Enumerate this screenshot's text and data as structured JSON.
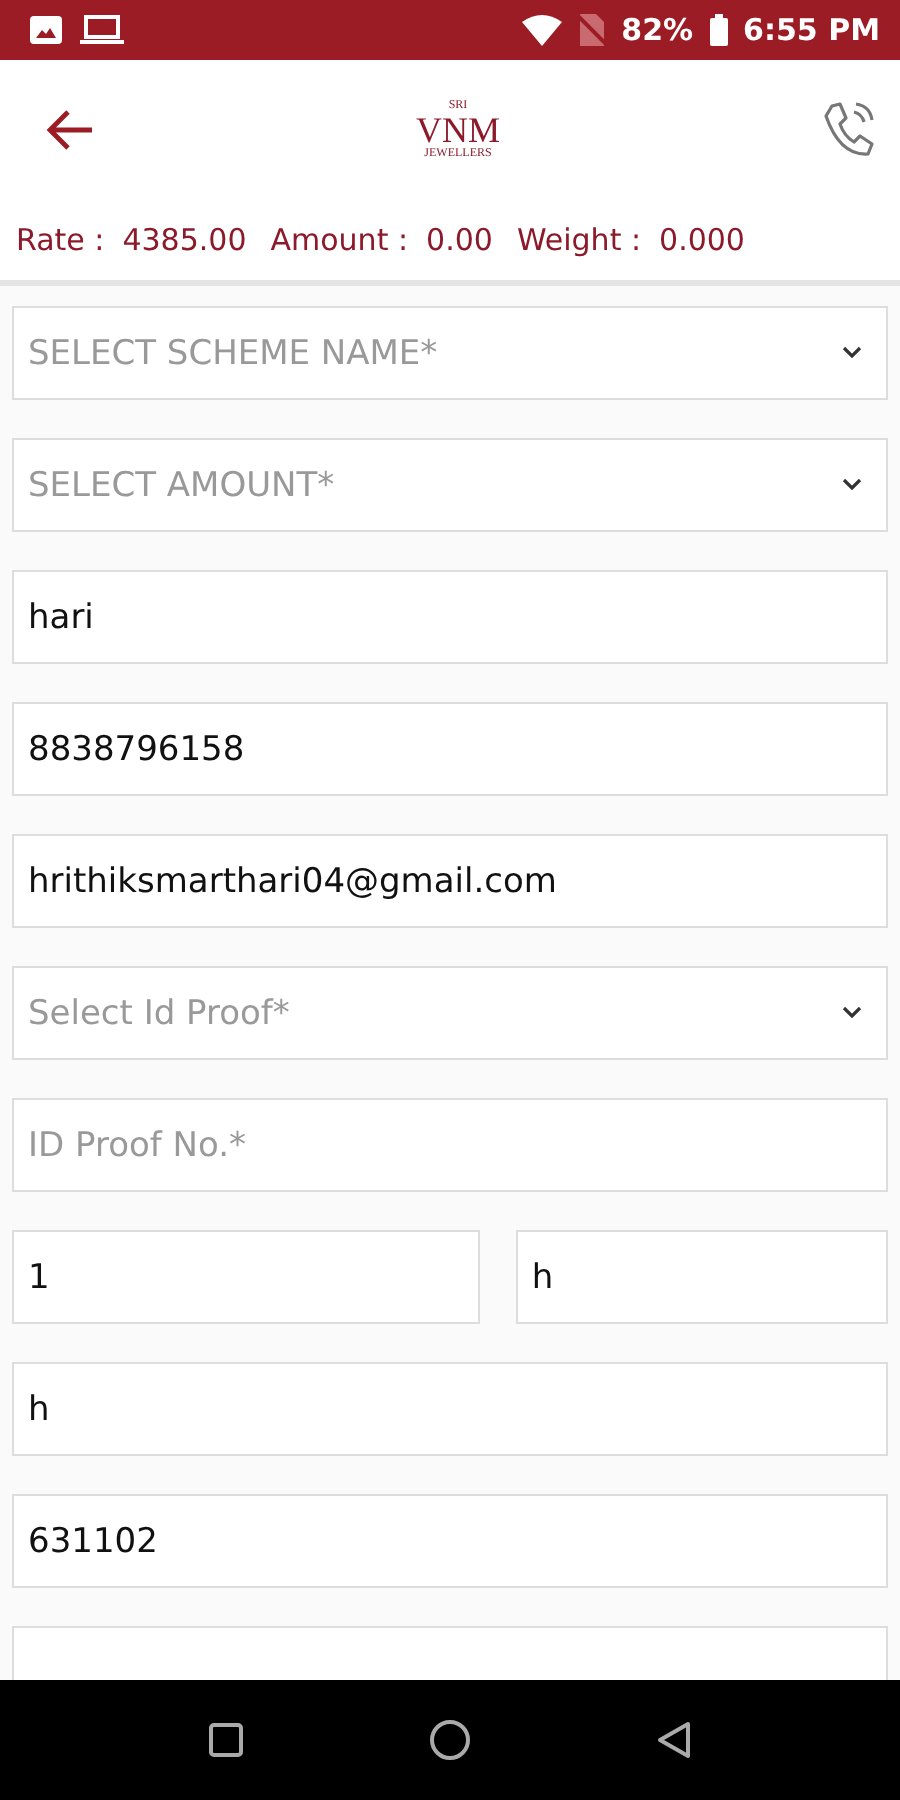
{
  "status_bar": {
    "battery": "82%",
    "time": "6:55 PM"
  },
  "header": {
    "logo_top": "SRI",
    "logo_main": "VNM",
    "logo_sub": "JEWELLERS"
  },
  "summary": [
    {
      "label": "Rate :",
      "value": "4385.00"
    },
    {
      "label": "Amount :",
      "value": "0.00"
    },
    {
      "label": "Weight :",
      "value": "0.000"
    }
  ],
  "form": [
    {
      "kind": "select",
      "placeholder": "SELECT SCHEME NAME*"
    },
    {
      "kind": "select",
      "placeholder": "SELECT AMOUNT*"
    },
    {
      "kind": "input",
      "value": "hari"
    },
    {
      "kind": "input",
      "value": "8838796158"
    },
    {
      "kind": "input",
      "value": "hrithiksmarthari04@gmail.com"
    },
    {
      "kind": "select",
      "placeholder": "Select Id Proof*"
    },
    {
      "kind": "input",
      "placeholder": "ID Proof No.*"
    },
    {
      "kind": "pair",
      "items": [
        {
          "value": "1"
        },
        {
          "value": "h"
        }
      ]
    },
    {
      "kind": "input",
      "value": "h"
    },
    {
      "kind": "input",
      "value": "631102"
    },
    {
      "kind": "cut"
    }
  ]
}
